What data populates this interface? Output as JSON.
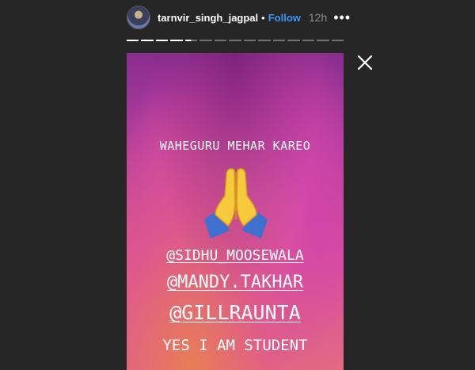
{
  "header": {
    "username": "tarnvir_singh_jagpal",
    "separator": "•",
    "follow_label": "Follow",
    "time": "12h",
    "more_icon": "more-options-icon"
  },
  "progress": {
    "segments_total": 15,
    "segments_completed": 4,
    "current_segment_progress": 0.5
  },
  "story": {
    "line1": "WAHEGURU MEHAR KAREO",
    "emoji": "folded-hands",
    "mention1": "@SIDHU_MOOSEWALA",
    "mention2": "@MANDY.TAKHAR",
    "mention3": "@GILLRAUNTA",
    "line5": "YES I AM STUDENT"
  },
  "close_icon": "close-icon",
  "colors": {
    "background": "#262626",
    "follow": "#3897f0",
    "time": "#8e8e8e"
  }
}
